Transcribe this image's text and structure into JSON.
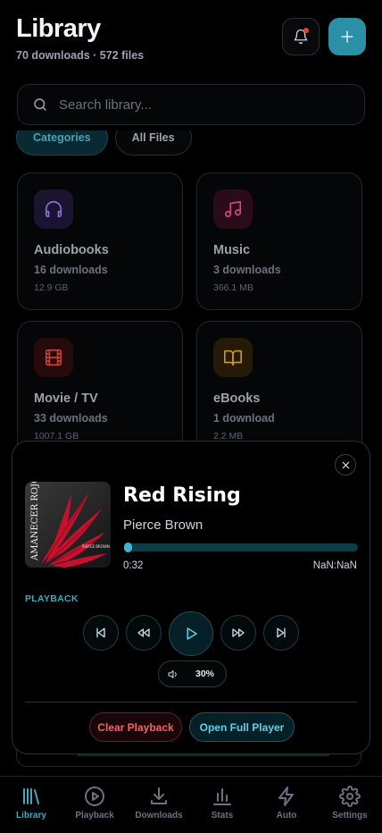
{
  "header": {
    "title": "Library",
    "subtitle": "70 downloads · 572 files",
    "plus_symbol": "+"
  },
  "search": {
    "placeholder": "Search library..."
  },
  "chips": [
    {
      "label": "Categories",
      "active": true
    },
    {
      "label": "All Files",
      "active": false
    }
  ],
  "categories": [
    {
      "title": "Audiobooks",
      "count": "16 downloads",
      "size": "12.9 GB",
      "icon": "headphones-icon",
      "color": "#8b6fd6",
      "bg": "#1a1430"
    },
    {
      "title": "Music",
      "count": "3 downloads",
      "size": "366.1 MB",
      "icon": "music-note-icon",
      "color": "#d9467e",
      "bg": "#2a0c18"
    },
    {
      "title": "Movie / TV",
      "count": "33 downloads",
      "size": "1007.1 GB",
      "icon": "film-icon",
      "color": "#c53f36",
      "bg": "#260b0a"
    },
    {
      "title": "eBooks",
      "count": "1 download",
      "size": "2.2 MB",
      "icon": "book-open-icon",
      "color": "#c89622",
      "bg": "#241a05"
    }
  ],
  "player": {
    "title": "Red Rising",
    "author": "Pierce Brown",
    "current_time": "0:32",
    "duration": "NaN:NaN",
    "progress_fraction": 0.0,
    "section_label": "PLAYBACK",
    "volume": "30%",
    "cover_title": "AMANECER ROJO",
    "cover_author": "PIERCE BROWN",
    "clear_label": "Clear Playback",
    "open_label": "Open Full Player"
  },
  "nav": {
    "items": [
      {
        "label": "Library",
        "icon": "library-icon",
        "active": true
      },
      {
        "label": "Playback",
        "icon": "play-circle-icon",
        "active": false
      },
      {
        "label": "Downloads",
        "icon": "download-icon",
        "active": false
      },
      {
        "label": "Stats",
        "icon": "bar-chart-icon",
        "active": false
      },
      {
        "label": "Auto",
        "icon": "lightning-icon",
        "active": false
      },
      {
        "label": "Settings",
        "icon": "gear-icon",
        "active": false
      }
    ]
  },
  "colors": {
    "accent": "#3fa9c1",
    "danger": "#f06464",
    "background": "#000000"
  }
}
